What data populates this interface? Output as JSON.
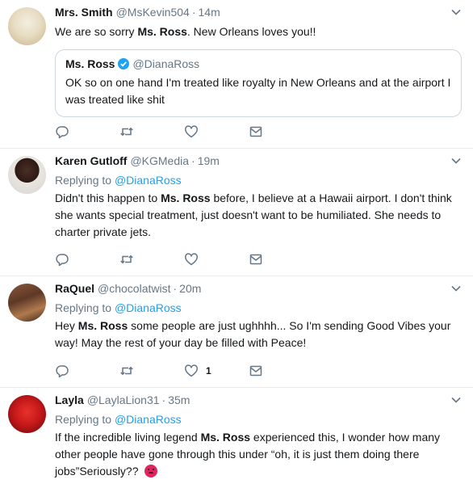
{
  "colors": {
    "link": "#1da1f2",
    "muted": "#657786",
    "border": "#e6ecf0",
    "verified": "#1da1f2",
    "angry_emoji": "#e0245e"
  },
  "icons": [
    "reply-icon",
    "retweet-icon",
    "like-icon",
    "direct-message-icon",
    "caret-down-icon",
    "verified-badge-icon",
    "angry-face-emoji"
  ],
  "tweets": [
    {
      "name": "Mrs. Smith",
      "handle": "@MsKevin504",
      "separator": "·",
      "time": "14m",
      "text_before": "We are so sorry ",
      "text_bold": "Ms. Ross",
      "text_after": ". New Orleans loves you!!",
      "quote": {
        "name": "Ms. Ross",
        "handle": "@DianaRoss",
        "text": "OK so on one hand I'm treated like royalty in New Orleans and at the airport I was treated like shit"
      },
      "like_count": ""
    },
    {
      "name": "Karen Gutloff",
      "handle": "@KGMedia",
      "separator": "·",
      "time": "19m",
      "replying_prefix": "Replying to ",
      "replying_to": "@DianaRoss",
      "text_before": "Didn't this happen to ",
      "text_bold": "Ms. Ross",
      "text_after": " before, I believe at a Hawaii airport. I don't  think she wants special treatment, just doesn't want to be humiliated. She needs to charter private jets.",
      "like_count": ""
    },
    {
      "name": "RaQuel",
      "handle": "@chocolatwist",
      "separator": "·",
      "time": "20m",
      "replying_prefix": "Replying to ",
      "replying_to": "@DianaRoss",
      "text_before": "Hey ",
      "text_bold": "Ms. Ross",
      "text_after": " some people are just ughhhh... So I'm sending Good Vibes your way! May the rest of your day be filled with Peace!",
      "like_count": "1"
    },
    {
      "name": "Layla",
      "handle": "@LaylaLion31",
      "separator": "·",
      "time": "35m",
      "replying_prefix": "Replying to ",
      "replying_to": "@DianaRoss",
      "text_before": "If the incredible living legend ",
      "text_bold": "Ms. Ross",
      "text_after": " experienced this, I wonder how many other people have gone through this under “oh, it is just them doing there jobs”Seriously?? ",
      "like_count": ""
    }
  ]
}
